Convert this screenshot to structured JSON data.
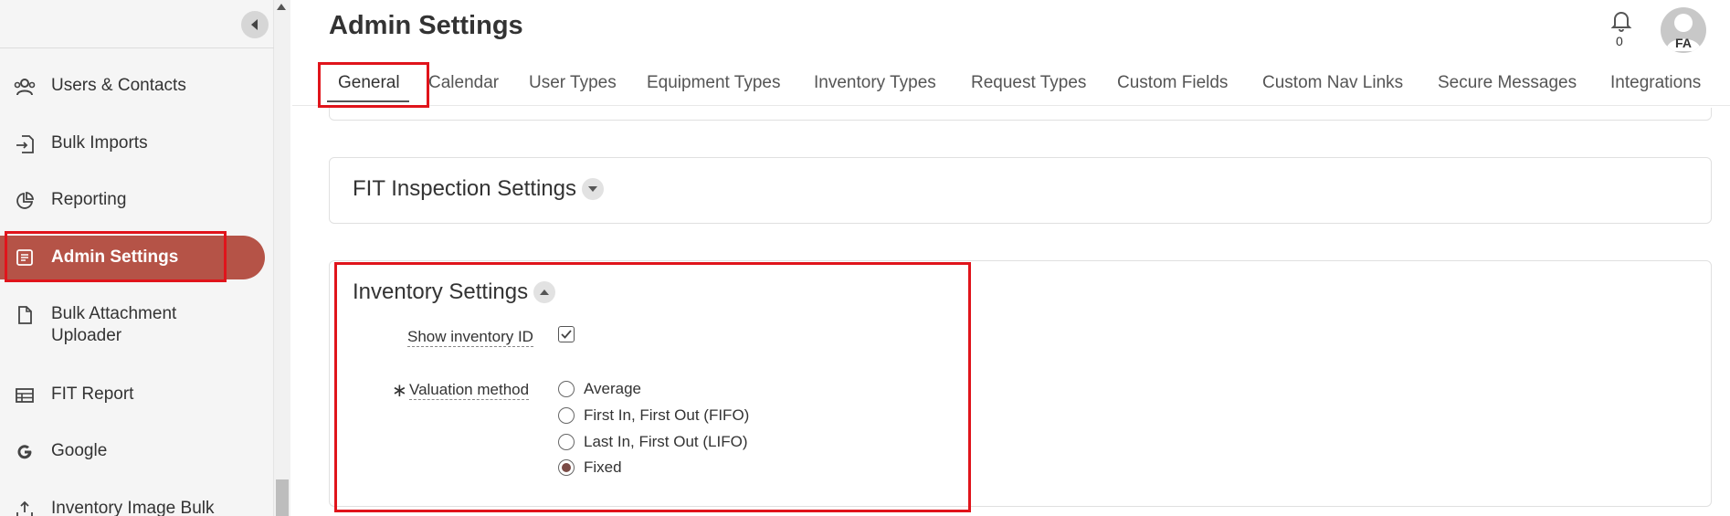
{
  "sidebar": {
    "items": [
      {
        "label": "Users & Contacts",
        "icon": "users-icon"
      },
      {
        "label": "Bulk Imports",
        "icon": "import-icon"
      },
      {
        "label": "Reporting",
        "icon": "pie-chart-icon"
      },
      {
        "label": "Admin Settings",
        "icon": "settings-list-icon"
      },
      {
        "label": "Bulk Attachment Uploader",
        "icon": "document-icon"
      },
      {
        "label": "FIT Report",
        "icon": "table-icon"
      },
      {
        "label": "Google",
        "icon": "google-icon"
      },
      {
        "label": "Inventory Image Bulk",
        "icon": "upload-icon"
      }
    ],
    "active_item": "Admin Settings"
  },
  "header": {
    "title": "Admin Settings",
    "notifications_count": "0",
    "avatar_initials": "FA"
  },
  "tabs": [
    {
      "label": "General",
      "active": true
    },
    {
      "label": "Calendar"
    },
    {
      "label": "User Types"
    },
    {
      "label": "Equipment Types"
    },
    {
      "label": "Inventory Types"
    },
    {
      "label": "Request Types"
    },
    {
      "label": "Custom Fields"
    },
    {
      "label": "Custom Nav Links"
    },
    {
      "label": "Secure Messages"
    },
    {
      "label": "Integrations"
    }
  ],
  "fit_section": {
    "title": "FIT Inspection Settings"
  },
  "inventory_section": {
    "title": "Inventory Settings",
    "show_inventory_id_label": "Show inventory ID",
    "show_inventory_id_checked": true,
    "valuation_label": "Valuation method",
    "required_marker": "∗",
    "valuation_options": [
      {
        "label": "Average",
        "checked": false
      },
      {
        "label": "First In, First Out (FIFO)",
        "checked": false
      },
      {
        "label": "Last In, First Out (LIFO)",
        "checked": false
      },
      {
        "label": "Fixed",
        "checked": true
      }
    ]
  },
  "colors": {
    "active_nav": "#b55347",
    "annotation": "#e0141b"
  }
}
